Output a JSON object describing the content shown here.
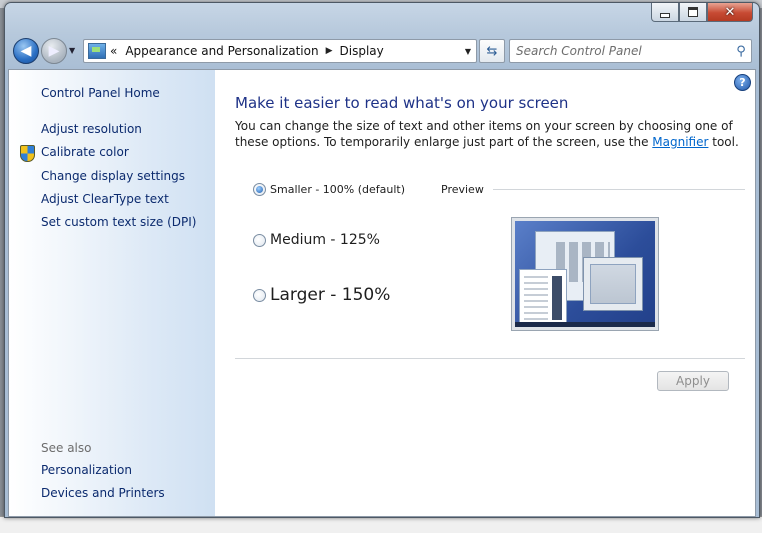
{
  "window": {
    "caption_buttons": {
      "minimize": "minimize-icon",
      "maximize": "maximize-icon",
      "close": "close-icon"
    }
  },
  "navbar": {
    "address": {
      "icon": "control-panel-icon",
      "overflow": "«",
      "crumbs": [
        "Appearance and Personalization",
        "Display"
      ],
      "separator": "▶"
    },
    "search": {
      "placeholder": "Search Control Panel",
      "value": ""
    }
  },
  "sidebar": {
    "home": "Control Panel Home",
    "links": [
      "Adjust resolution",
      "Calibrate color",
      "Change display settings",
      "Adjust ClearType text",
      "Set custom text size (DPI)"
    ],
    "see_also_label": "See also",
    "see_also_links": [
      "Personalization",
      "Devices and Printers"
    ]
  },
  "main": {
    "heading": "Make it easier to read what's on your screen",
    "description_pre": "You can change the size of text and other items on your screen by choosing one of these options. To temporarily enlarge just part of the screen, use the ",
    "description_link": "Magnifier",
    "description_post": " tool.",
    "options": [
      {
        "label": "Smaller - 100% (default)",
        "checked": true
      },
      {
        "label": "Medium - 125%",
        "checked": false
      },
      {
        "label": "Larger - 150%",
        "checked": false
      }
    ],
    "preview_label": "Preview",
    "apply_label": "Apply",
    "apply_enabled": false
  },
  "colors": {
    "heading": "#1e3287",
    "link": "#0b2a6e",
    "hyperlink": "#0066cc"
  }
}
